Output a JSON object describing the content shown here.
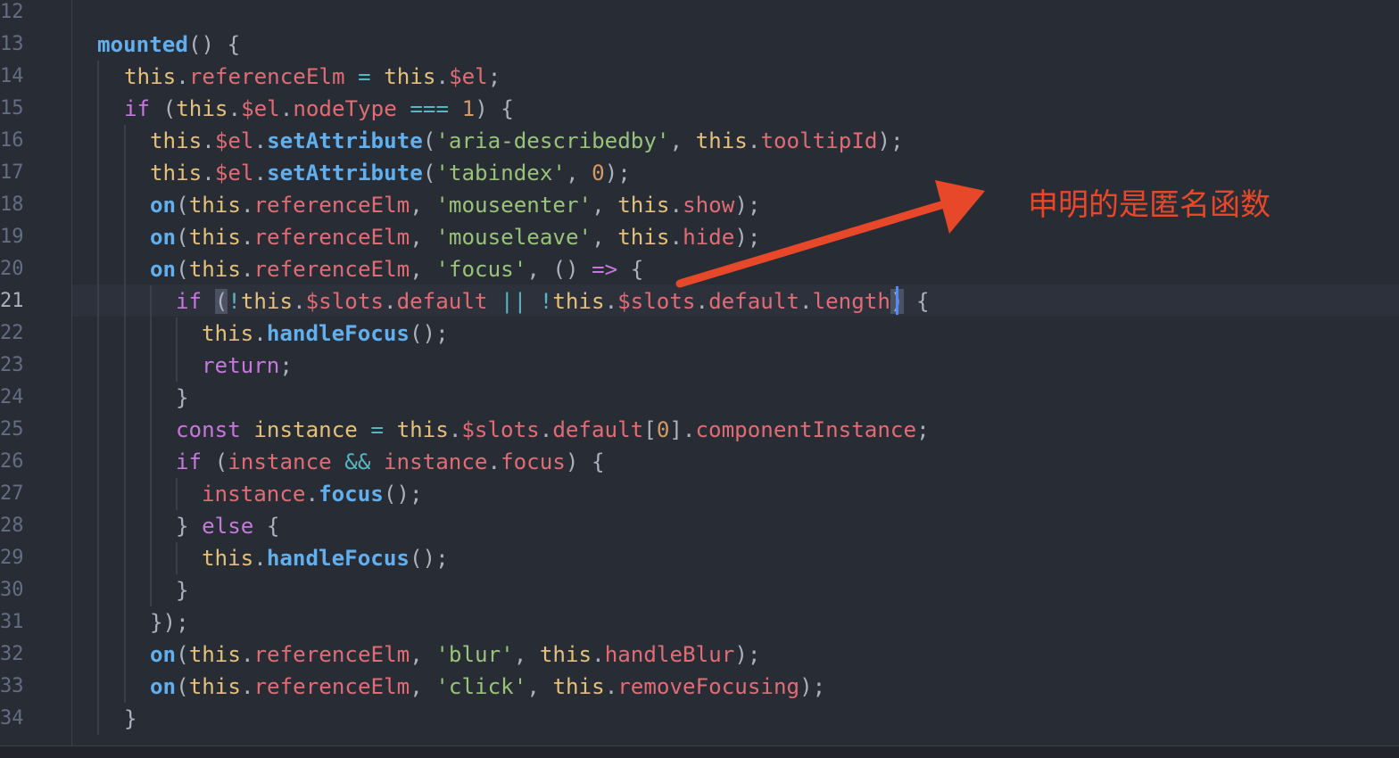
{
  "line_numbers": [
    "12",
    "13",
    "14",
    "15",
    "16",
    "17",
    "18",
    "19",
    "20",
    "21",
    "22",
    "23",
    "24",
    "25",
    "26",
    "27",
    "28",
    "29",
    "30",
    "31",
    "32",
    "33",
    "34"
  ],
  "active_line_number": "21",
  "code": {
    "l13": {
      "a": "mounted",
      "b": "() {"
    },
    "l14": {
      "a": "this",
      "b": ".",
      "c": "referenceElm",
      "d": " = ",
      "e": "this",
      "f": ".",
      "g": "$el",
      "h": ";"
    },
    "l15": {
      "a": "if",
      "b": " (",
      "c": "this",
      "d": ".",
      "e": "$el",
      "f": ".",
      "g": "nodeType",
      "h": " === ",
      "i": "1",
      "j": ") {"
    },
    "l16": {
      "a": "this",
      "b": ".",
      "c": "$el",
      "d": ".",
      "e": "setAttribute",
      "f": "(",
      "g": "'aria-describedby'",
      "h": ", ",
      "i": "this",
      "j": ".",
      "k": "tooltipId",
      "l": ");"
    },
    "l17": {
      "a": "this",
      "b": ".",
      "c": "$el",
      "d": ".",
      "e": "setAttribute",
      "f": "(",
      "g": "'tabindex'",
      "h": ", ",
      "i": "0",
      "j": ");"
    },
    "l18": {
      "a": "on",
      "b": "(",
      "c": "this",
      "d": ".",
      "e": "referenceElm",
      "f": ", ",
      "g": "'mouseenter'",
      "h": ", ",
      "i": "this",
      "j": ".",
      "k": "show",
      "l": ");"
    },
    "l19": {
      "a": "on",
      "b": "(",
      "c": "this",
      "d": ".",
      "e": "referenceElm",
      "f": ", ",
      "g": "'mouseleave'",
      "h": ", ",
      "i": "this",
      "j": ".",
      "k": "hide",
      "l": ");"
    },
    "l20": {
      "a": "on",
      "b": "(",
      "c": "this",
      "d": ".",
      "e": "referenceElm",
      "f": ", ",
      "g": "'focus'",
      "h": ", () ",
      "i": "=>",
      "j": " {"
    },
    "l21": {
      "a": "if",
      "b": " ",
      "c": "(",
      "d": "!",
      "e": "this",
      "f": ".",
      "g": "$slots",
      "h": ".",
      "i": "default",
      "j": " || ",
      "k": "!",
      "l": "this",
      "m": ".",
      "n": "$slots",
      "o": ".",
      "p": "default",
      "q": ".",
      "r": "length",
      "s": ")",
      "t": " {"
    },
    "l22": {
      "a": "this",
      "b": ".",
      "c": "handleFocus",
      "d": "();"
    },
    "l23": {
      "a": "return",
      "b": ";"
    },
    "l24": {
      "a": "}"
    },
    "l25": {
      "a": "const",
      "b": " ",
      "c": "instance",
      "d": " = ",
      "e": "this",
      "f": ".",
      "g": "$slots",
      "h": ".",
      "i": "default",
      "j": "[",
      "k": "0",
      "l": "].",
      "m": "componentInstance",
      "n": ";"
    },
    "l26": {
      "a": "if",
      "b": " (",
      "c": "instance",
      "d": " && ",
      "e": "instance",
      "f": ".",
      "g": "focus",
      "h": ") {"
    },
    "l27": {
      "a": "instance",
      "b": ".",
      "c": "focus",
      "d": "();"
    },
    "l28": {
      "a": "} ",
      "b": "else",
      "c": " {"
    },
    "l29": {
      "a": "this",
      "b": ".",
      "c": "handleFocus",
      "d": "();"
    },
    "l30": {
      "a": "}"
    },
    "l31": {
      "a": "});"
    },
    "l32": {
      "a": "on",
      "b": "(",
      "c": "this",
      "d": ".",
      "e": "referenceElm",
      "f": ", ",
      "g": "'blur'",
      "h": ", ",
      "i": "this",
      "j": ".",
      "k": "handleBlur",
      "l": ");"
    },
    "l33": {
      "a": "on",
      "b": "(",
      "c": "this",
      "d": ".",
      "e": "referenceElm",
      "f": ", ",
      "g": "'click'",
      "h": ", ",
      "i": "this",
      "j": ".",
      "k": "removeFocusing",
      "l": ");"
    },
    "l34": {
      "a": "}"
    }
  },
  "annotation": {
    "text": "申明的是匿名函数",
    "color": "#e8482a"
  },
  "colors": {
    "background": "#282c34",
    "keyword": "#c678dd",
    "function": "#61afef",
    "this": "#e5c07b",
    "property": "#e06c75",
    "string": "#98c379",
    "number": "#d19a66",
    "operator": "#56b6c2",
    "cursor": "#528bff"
  }
}
